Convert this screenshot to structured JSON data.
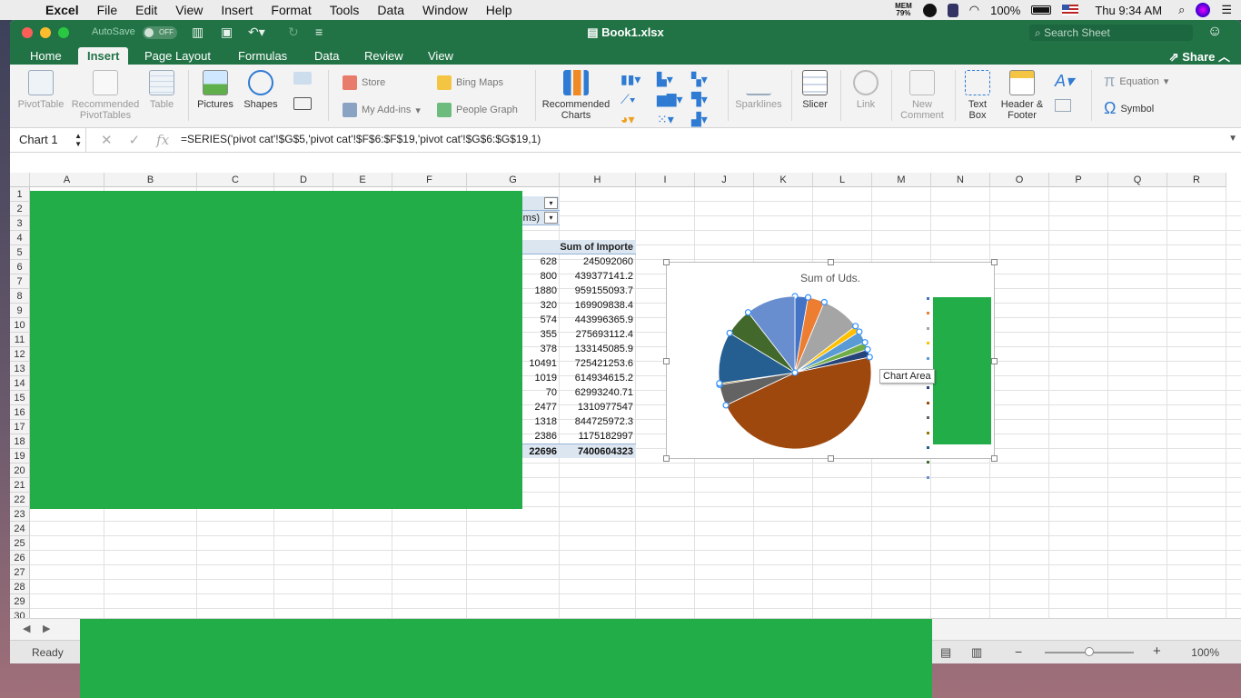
{
  "menubar": {
    "app": "Excel",
    "items": [
      "File",
      "Edit",
      "View",
      "Insert",
      "Format",
      "Tools",
      "Data",
      "Window",
      "Help"
    ],
    "mem_label": "MEM",
    "mem_value": "79%",
    "battery": "100%",
    "clock": "Thu 9:34 AM"
  },
  "window": {
    "autosave_label": "AutoSave",
    "autosave_state": "OFF",
    "title": "Book1.xlsx",
    "search_placeholder": "Search Sheet"
  },
  "tabs": [
    "Home",
    "Insert",
    "Page Layout",
    "Formulas",
    "Data",
    "Review",
    "View"
  ],
  "active_tab": "Insert",
  "share_label": "Share",
  "ribbon": {
    "pivottable": "PivotTable",
    "recommended_pivot_1": "Recommended",
    "recommended_pivot_2": "PivotTables",
    "table": "Table",
    "pictures": "Pictures",
    "shapes": "Shapes",
    "store": "Store",
    "my_addins": "My Add-ins",
    "bing_maps": "Bing Maps",
    "people_graph": "People Graph",
    "recommended_charts_1": "Recommended",
    "recommended_charts_2": "Charts",
    "sparklines": "Sparklines",
    "slicer": "Slicer",
    "link": "Link",
    "new_comment_1": "New",
    "new_comment_2": "Comment",
    "text_box_1": "Text",
    "text_box_2": "Box",
    "header_footer_1": "Header &",
    "header_footer_2": "Footer",
    "equation": "Equation",
    "symbol": "Symbol"
  },
  "formula_bar": {
    "name_box": "Chart 1",
    "formula": "=SERIES('pivot cat'!$G$5,'pivot cat'!$F$6:$F$19,'pivot cat'!$G$6:$G$19,1)"
  },
  "columns": [
    "A",
    "B",
    "C",
    "D",
    "E",
    "F",
    "G",
    "H",
    "I",
    "J",
    "K",
    "L",
    "M",
    "N",
    "O",
    "P",
    "Q",
    "R"
  ],
  "rows": [
    "1",
    "2",
    "3",
    "4",
    "5",
    "6",
    "7",
    "8",
    "9",
    "10",
    "11",
    "12",
    "13",
    "14",
    "15",
    "16",
    "17",
    "18",
    "19",
    "20",
    "21",
    "22",
    "23",
    "24",
    "25",
    "26",
    "27",
    "28",
    "29",
    "30"
  ],
  "pivot": {
    "partial_label": "ems)",
    "header_h": "Sum of Importe",
    "g_values": [
      "628",
      "800",
      "1880",
      "320",
      "574",
      "355",
      "378",
      "10491",
      "1019",
      "70",
      "2477",
      "1318",
      "2386"
    ],
    "h_values": [
      "245092060",
      "439377141.2",
      "959155093.7",
      "169909838.4",
      "443996365.9",
      "275693112.4",
      "133145085.9",
      "725421253.6",
      "614934615.2",
      "62993240.71",
      "1310977547",
      "844725972.3",
      "1175182997"
    ],
    "total_g": "22696",
    "total_h": "7400604323"
  },
  "chart": {
    "title": "Sum of Uds.",
    "tooltip": "Chart Area"
  },
  "chart_data": {
    "type": "pie",
    "title": "Sum of Uds.",
    "values": [
      628,
      800,
      1880,
      320,
      574,
      355,
      378,
      10491,
      1019,
      70,
      2477,
      1318,
      2386
    ],
    "colors": [
      "#4472c4",
      "#ed7d31",
      "#a5a5a5",
      "#ffc000",
      "#5b9bd5",
      "#70ad47",
      "#264478",
      "#9e480e",
      "#636363",
      "#997300",
      "#255e91",
      "#43682b",
      "#698ed0"
    ],
    "legend": "right"
  },
  "status": {
    "ready": "Ready",
    "zoom": "100%"
  }
}
